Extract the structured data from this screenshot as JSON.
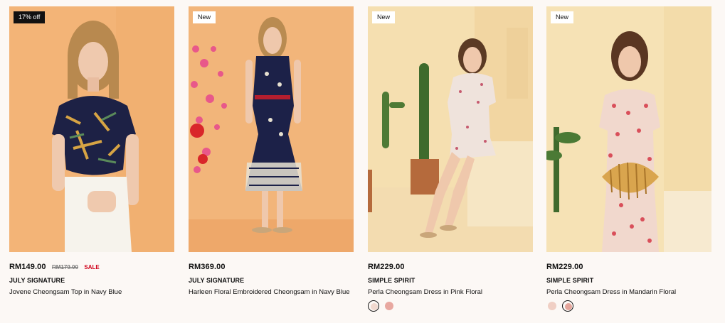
{
  "products": [
    {
      "badge": "17% off",
      "price": "RM149.00",
      "old_price": "RM179.00",
      "sale_label": "SALE",
      "brand": "JULY SIGNATURE",
      "name": "Jovene Cheongsam Top in Navy Blue",
      "image": "model-navy-printed-top-white-shorts",
      "bg_color": "#f3b477"
    },
    {
      "badge": "New",
      "price": "RM369.00",
      "brand": "JULY SIGNATURE",
      "name": "Harleen Floral Embroidered Cheongsam in Navy Blue",
      "image": "model-navy-embroidered-dress-peach-blossoms",
      "bg_color": "#f2b57a"
    },
    {
      "badge": "New",
      "price": "RM229.00",
      "brand": "SIMPLE SPIRIT",
      "name": "Perla Cheongsam Dress in Pink Floral",
      "image": "model-seated-pink-floral-dress-cactus",
      "bg_color": "#f5dfb0",
      "swatches": [
        {
          "color": "#f1d9cf",
          "selected": true
        },
        {
          "color": "#e8a8a0",
          "selected": false
        }
      ]
    },
    {
      "badge": "New",
      "price": "RM229.00",
      "brand": "SIMPLE SPIRIT",
      "name": "Perla Cheongsam Dress in Mandarin Floral",
      "image": "model-mandarin-floral-dress-bamboo-bag",
      "bg_color": "#f6e2b5",
      "swatches": [
        {
          "color": "#f0cfc4",
          "selected": false
        },
        {
          "color": "#e5a59b",
          "selected": true
        }
      ]
    }
  ]
}
